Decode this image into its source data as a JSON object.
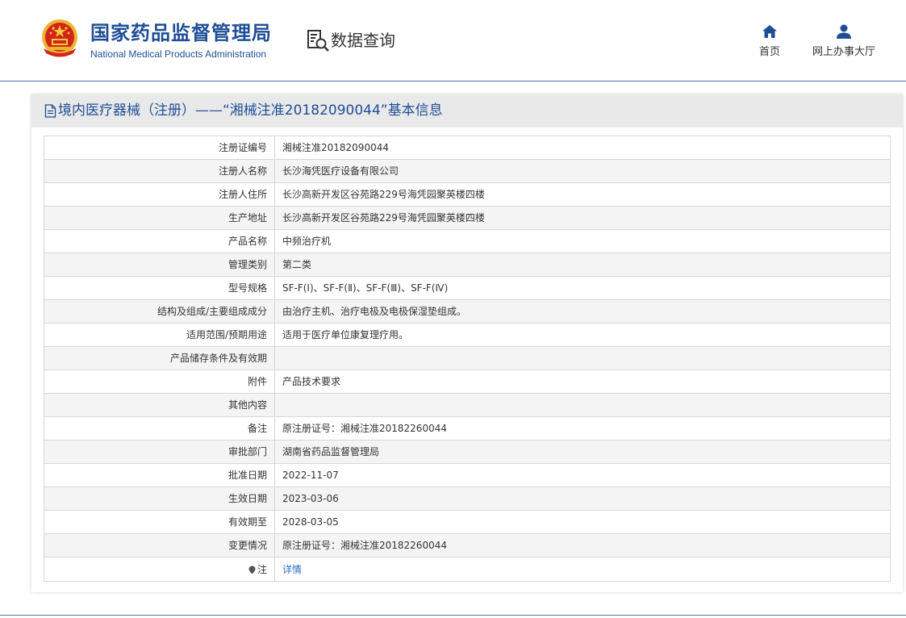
{
  "header": {
    "brand_cn": "国家药品监督管理局",
    "brand_en": "National Medical Products Administration",
    "query_label": "数据查询",
    "nav": {
      "home": "首页",
      "office": "网上办事大厅"
    }
  },
  "panel": {
    "title": "境内医疗器械（注册）——“湘械注准20182090044”基本信息"
  },
  "rows": [
    {
      "label": "注册证编号",
      "value": "湘械注准20182090044"
    },
    {
      "label": "注册人名称",
      "value": "长沙海凭医疗设备有限公司"
    },
    {
      "label": "注册人住所",
      "value": "长沙高新开发区谷苑路229号海凭园聚英楼四楼"
    },
    {
      "label": "生产地址",
      "value": "长沙高新开发区谷苑路229号海凭园聚英楼四楼"
    },
    {
      "label": "产品名称",
      "value": "中频治疗机"
    },
    {
      "label": "管理类别",
      "value": "第二类"
    },
    {
      "label": "型号规格",
      "value": "SF-F(Ⅰ)、SF-F(Ⅱ)、SF-F(Ⅲ)、SF-F(Ⅳ)"
    },
    {
      "label": "结构及组成/主要组成成分",
      "value": "由治疗主机、治疗电极及电极保湿垫组成。"
    },
    {
      "label": "适用范围/预期用途",
      "value": "适用于医疗单位康复理疗用。"
    },
    {
      "label": "产品储存条件及有效期",
      "value": ""
    },
    {
      "label": "附件",
      "value": "产品技术要求"
    },
    {
      "label": "其他内容",
      "value": ""
    },
    {
      "label": "备注",
      "value": "原注册证号：湘械注准20182260044"
    },
    {
      "label": "审批部门",
      "value": "湖南省药品监督管理局"
    },
    {
      "label": "批准日期",
      "value": "2022-11-07"
    },
    {
      "label": "生效日期",
      "value": "2023-03-06"
    },
    {
      "label": "有效期至",
      "value": "2028-03-05"
    },
    {
      "label": "变更情况",
      "value": "原注册证号：湘械注准20182260044"
    }
  ],
  "note_row": {
    "label": "注",
    "link": "详情"
  },
  "colors": {
    "brand_blue": "#1f4e96",
    "link_blue": "#2b6cc4",
    "emblem_red": "#d4231b",
    "emblem_gold": "#e9b530"
  },
  "icons": {
    "emblem": "national-emblem-icon",
    "query": "document-search-icon",
    "home": "home-icon",
    "office": "user-icon",
    "title": "document-icon",
    "note": "location-pin-icon"
  }
}
